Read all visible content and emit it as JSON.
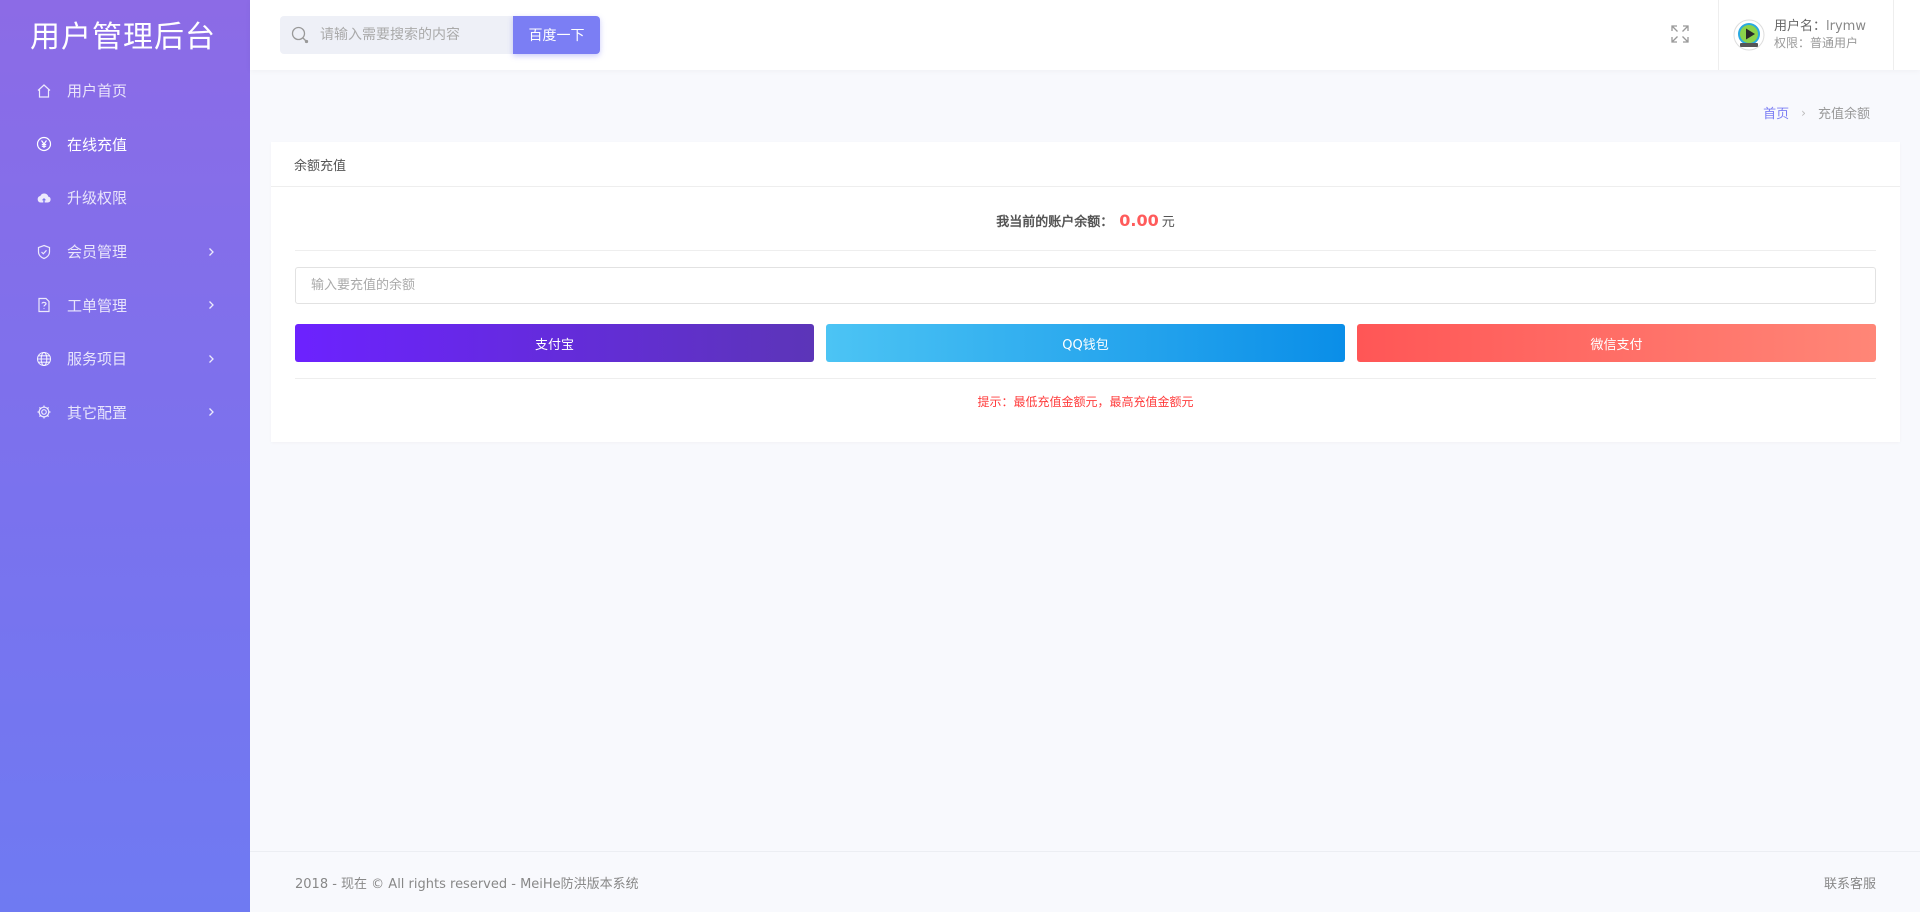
{
  "brand": {
    "title": "用户管理后台"
  },
  "sidebar": {
    "items": [
      {
        "label": "用户首页",
        "icon": "home-icon",
        "has_children": false
      },
      {
        "label": "在线充值",
        "icon": "yen-icon",
        "has_children": false,
        "active": true
      },
      {
        "label": "升级权限",
        "icon": "cloud-upload-icon",
        "has_children": false
      },
      {
        "label": "会员管理",
        "icon": "shield-check-icon",
        "has_children": true
      },
      {
        "label": "工单管理",
        "icon": "ticket-icon",
        "has_children": true
      },
      {
        "label": "服务项目",
        "icon": "globe-icon",
        "has_children": true
      },
      {
        "label": "其它配置",
        "icon": "gear-icon",
        "has_children": true
      }
    ]
  },
  "header": {
    "search": {
      "placeholder": "请输入需要搜索的内容",
      "button_label": "百度一下"
    },
    "user": {
      "name_label": "用户名：",
      "name": "lrymw",
      "role_label": "权限：",
      "role": "普通用户"
    }
  },
  "breadcrumb": {
    "home": "首页",
    "separator": "›",
    "current": "充值余额"
  },
  "card": {
    "title": "余额充值",
    "balance_label": "我当前的账户余额：",
    "balance_value": "0.00",
    "balance_unit": "元",
    "amount_placeholder": "输入要充值的余额",
    "buttons": {
      "alipay": "支付宝",
      "qq": "QQ钱包",
      "wechat": "微信支付"
    },
    "tip": "提示：最低充值金额元，最高充值金额元"
  },
  "footer": {
    "copyright": "2018 - 现在 © All rights reserved - MeiHe防洪版本系统",
    "contact": "联系客服"
  },
  "colors": {
    "accent": "#7b7ef4",
    "balance": "#ff5b5b",
    "tip": "#ff3c3c"
  }
}
